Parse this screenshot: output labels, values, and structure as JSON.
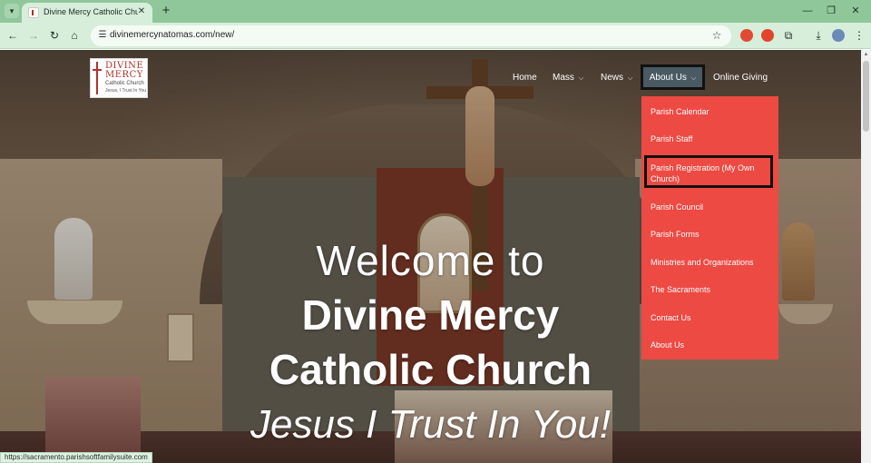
{
  "browser": {
    "tab_title": "Divine Mercy Catholic Church -",
    "url": "divinemercynatomas.com/new/",
    "status_url": "https://sacramento.parishsoftfamilysuite.com",
    "colors": {
      "frame": "#8fc79a",
      "toolbar": "#d7eedb"
    }
  },
  "logo": {
    "line1": "DIVINE",
    "line2": "MERCY",
    "line3": "Catholic Church",
    "line4": "Jesus, I Trust In You"
  },
  "nav": {
    "home": "Home",
    "mass": "Mass",
    "news": "News",
    "about": "About Us",
    "giving": "Online Giving"
  },
  "dropdown": {
    "items": [
      "Parish Calendar",
      "Parish Staff",
      "Parish Registration (My Own Church)",
      "Parish Council",
      "Parish Forms",
      "Ministries and Organizations",
      "The Sacraments",
      "Contact Us",
      "About Us"
    ],
    "color": "#ec4a43"
  },
  "hero": {
    "line1": "Welcome to",
    "line2": "Divine Mercy",
    "line3": "Catholic Church",
    "line4": "Jesus I Trust In You!"
  }
}
